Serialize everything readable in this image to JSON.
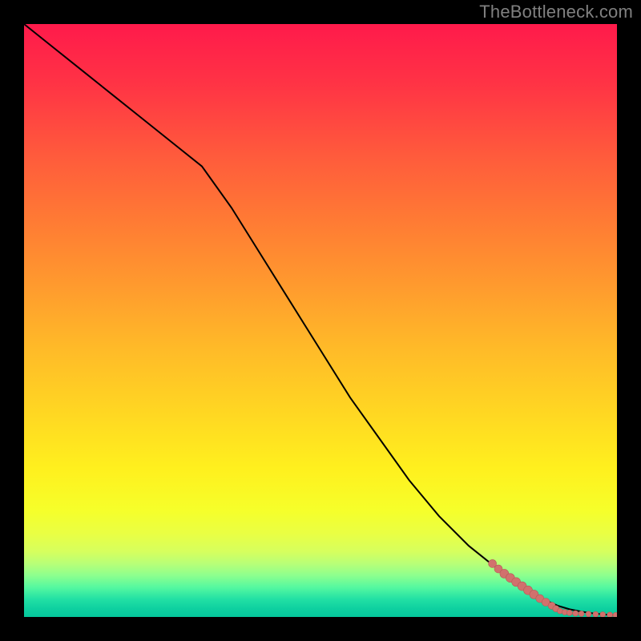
{
  "watermark": "TheBottleneck.com",
  "colors": {
    "line": "#000000",
    "point_fill": "#d1716d",
    "point_stroke": "#b85a56"
  },
  "chart_data": {
    "type": "line",
    "title": "",
    "xlabel": "",
    "ylabel": "",
    "xlim": [
      0,
      100
    ],
    "ylim": [
      0,
      100
    ],
    "series": [
      {
        "name": "curve",
        "x": [
          0,
          5,
          10,
          15,
          20,
          25,
          30,
          35,
          40,
          45,
          50,
          55,
          60,
          65,
          70,
          75,
          80,
          83,
          86,
          88,
          90,
          92,
          94,
          96,
          98,
          100
        ],
        "y": [
          100,
          96,
          92,
          88,
          84,
          80,
          76,
          69,
          61,
          53,
          45,
          37,
          30,
          23,
          17,
          12,
          8,
          6,
          4,
          2.8,
          1.9,
          1.3,
          0.9,
          0.6,
          0.4,
          0.3
        ]
      }
    ],
    "scatter": {
      "name": "highlight-points",
      "points": [
        {
          "x": 79,
          "y": 9.0,
          "r": 5
        },
        {
          "x": 80,
          "y": 8.1,
          "r": 5
        },
        {
          "x": 81,
          "y": 7.3,
          "r": 5.5
        },
        {
          "x": 82,
          "y": 6.6,
          "r": 5.5
        },
        {
          "x": 83,
          "y": 5.9,
          "r": 5.5
        },
        {
          "x": 84,
          "y": 5.2,
          "r": 5.5
        },
        {
          "x": 85,
          "y": 4.5,
          "r": 5.5
        },
        {
          "x": 86,
          "y": 3.8,
          "r": 5.5
        },
        {
          "x": 87,
          "y": 3.1,
          "r": 5
        },
        {
          "x": 88,
          "y": 2.5,
          "r": 5
        },
        {
          "x": 89,
          "y": 1.9,
          "r": 4.5
        },
        {
          "x": 89.7,
          "y": 1.4,
          "r": 4
        },
        {
          "x": 90.4,
          "y": 1.0,
          "r": 3.5
        },
        {
          "x": 91.2,
          "y": 0.8,
          "r": 3.5
        },
        {
          "x": 92.0,
          "y": 0.7,
          "r": 3.5
        },
        {
          "x": 93.0,
          "y": 0.6,
          "r": 3.5
        },
        {
          "x": 94.0,
          "y": 0.55,
          "r": 3.5
        },
        {
          "x": 95.2,
          "y": 0.5,
          "r": 3.5
        },
        {
          "x": 96.4,
          "y": 0.45,
          "r": 3.5
        },
        {
          "x": 97.6,
          "y": 0.4,
          "r": 3.5
        },
        {
          "x": 98.8,
          "y": 0.35,
          "r": 3.5
        },
        {
          "x": 99.8,
          "y": 0.3,
          "r": 3.5
        }
      ]
    }
  }
}
